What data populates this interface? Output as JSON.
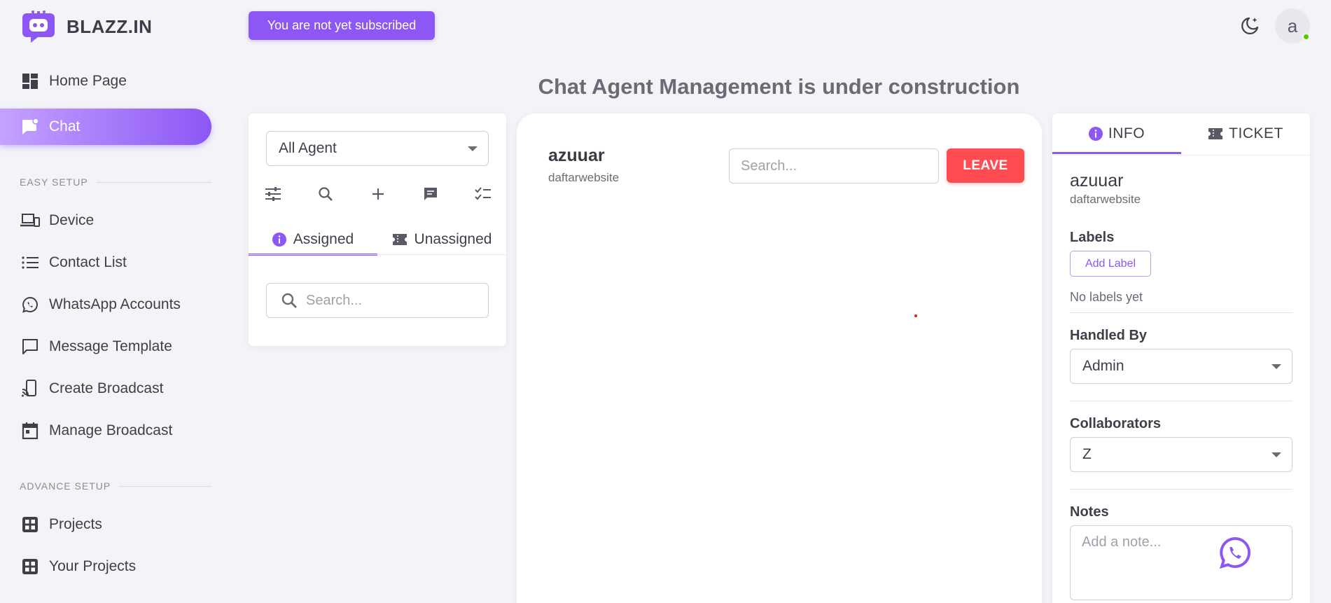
{
  "brand": {
    "name": "BLAZZ.IN"
  },
  "topbar": {
    "subscription_notice": "You are not yet subscribed",
    "avatar_letter": "a"
  },
  "page": {
    "title": "Chat Agent Management is under construction"
  },
  "sidebar": {
    "items": [
      {
        "label": "Home Page",
        "icon": "dashboard-icon"
      },
      {
        "label": "Chat",
        "icon": "chat-icon",
        "active": true
      }
    ],
    "section_easy": "EASY SETUP",
    "easy_items": [
      {
        "label": "Device",
        "icon": "devices-icon"
      },
      {
        "label": "Contact List",
        "icon": "list-icon"
      },
      {
        "label": "WhatsApp Accounts",
        "icon": "whatsapp-icon"
      },
      {
        "label": "Message Template",
        "icon": "message-icon"
      },
      {
        "label": "Create Broadcast",
        "icon": "cast-icon"
      },
      {
        "label": "Manage Broadcast",
        "icon": "calendar-icon"
      }
    ],
    "section_advance": "ADVANCE SETUP",
    "advance_items": [
      {
        "label": "Projects",
        "icon": "grid-icon"
      },
      {
        "label": "Your Projects",
        "icon": "grid-icon"
      }
    ]
  },
  "chat_list": {
    "agent_filter": "All Agent",
    "tabs": [
      {
        "label": "Assigned",
        "active": true
      },
      {
        "label": "Unassigned"
      }
    ],
    "search_placeholder": "Search..."
  },
  "chat": {
    "contact_name": "azuuar",
    "contact_sub": "daftarwebsite",
    "search_placeholder": "Search...",
    "leave_label": "LEAVE"
  },
  "info_panel": {
    "tabs": [
      {
        "label": "INFO",
        "active": true
      },
      {
        "label": "TICKET"
      }
    ],
    "name": "azuuar",
    "sub": "daftarwebsite",
    "labels_heading": "Labels",
    "add_label": "Add Label",
    "no_labels": "No labels yet",
    "handled_heading": "Handled By",
    "handled_value": "Admin",
    "collab_heading": "Collaborators",
    "collab_value": "Z",
    "notes_heading": "Notes",
    "notes_placeholder": "Add a note..."
  },
  "colors": {
    "accent": "#8c57f5",
    "danger": "#ff4c51",
    "online": "#56ca00"
  }
}
